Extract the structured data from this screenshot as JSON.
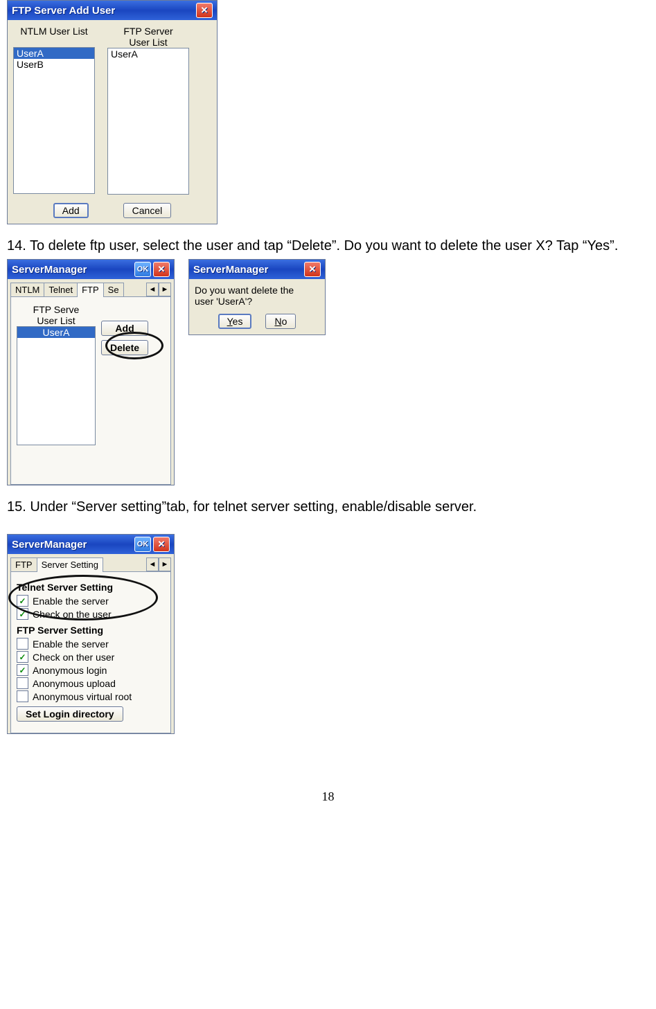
{
  "ss1": {
    "title": "FTP Server Add User",
    "left_label1": "NTLM User List",
    "right_label1": "FTP Server",
    "right_label2": "User List",
    "ntlm_users": [
      "UserA",
      "UserB"
    ],
    "ftp_users": [
      "UserA"
    ],
    "add_btn": "Add",
    "cancel_btn": "Cancel"
  },
  "instr14": "14. To delete ftp user, select the user and tap “Delete”. Do you want to delete the user X? Tap “Yes”.",
  "ss2": {
    "title": "ServerManager",
    "ok": "OK",
    "tabs": {
      "t1": "NTLM",
      "t2": "Telnet",
      "t3": "FTP",
      "t4": "Se"
    },
    "list_label1": "FTP Serve",
    "list_label2": "User List",
    "add_btn": "Add",
    "delete_btn": "Delete",
    "user": "UserA"
  },
  "ss2dlg": {
    "title": "ServerManager",
    "msg1": "Do you want delete the",
    "msg2": "user 'UserA'?",
    "yes_pre": "Y",
    "yes_rest": "es",
    "no_pre": "N",
    "no_rest": "o"
  },
  "instr15": "15. Under “Server setting”tab, for telnet server setting, enable/disable server.",
  "ss3": {
    "title": "ServerManager",
    "ok": "OK",
    "tabs": {
      "t1": "FTP",
      "t2": "Server Setting"
    },
    "telnet_title": "Telnet Server Setting",
    "telnet_enable": "Enable the server",
    "telnet_check": "Check on the user",
    "ftp_title": "FTP Server Setting",
    "ftp_enable": "Enable the server",
    "ftp_check": "Check on ther user",
    "ftp_anon_login": "Anonymous login",
    "ftp_anon_upload": "Anonymous upload",
    "ftp_anon_root": "Anonymous virtual root",
    "set_dir_btn": "Set Login directory"
  },
  "page_number": "18"
}
